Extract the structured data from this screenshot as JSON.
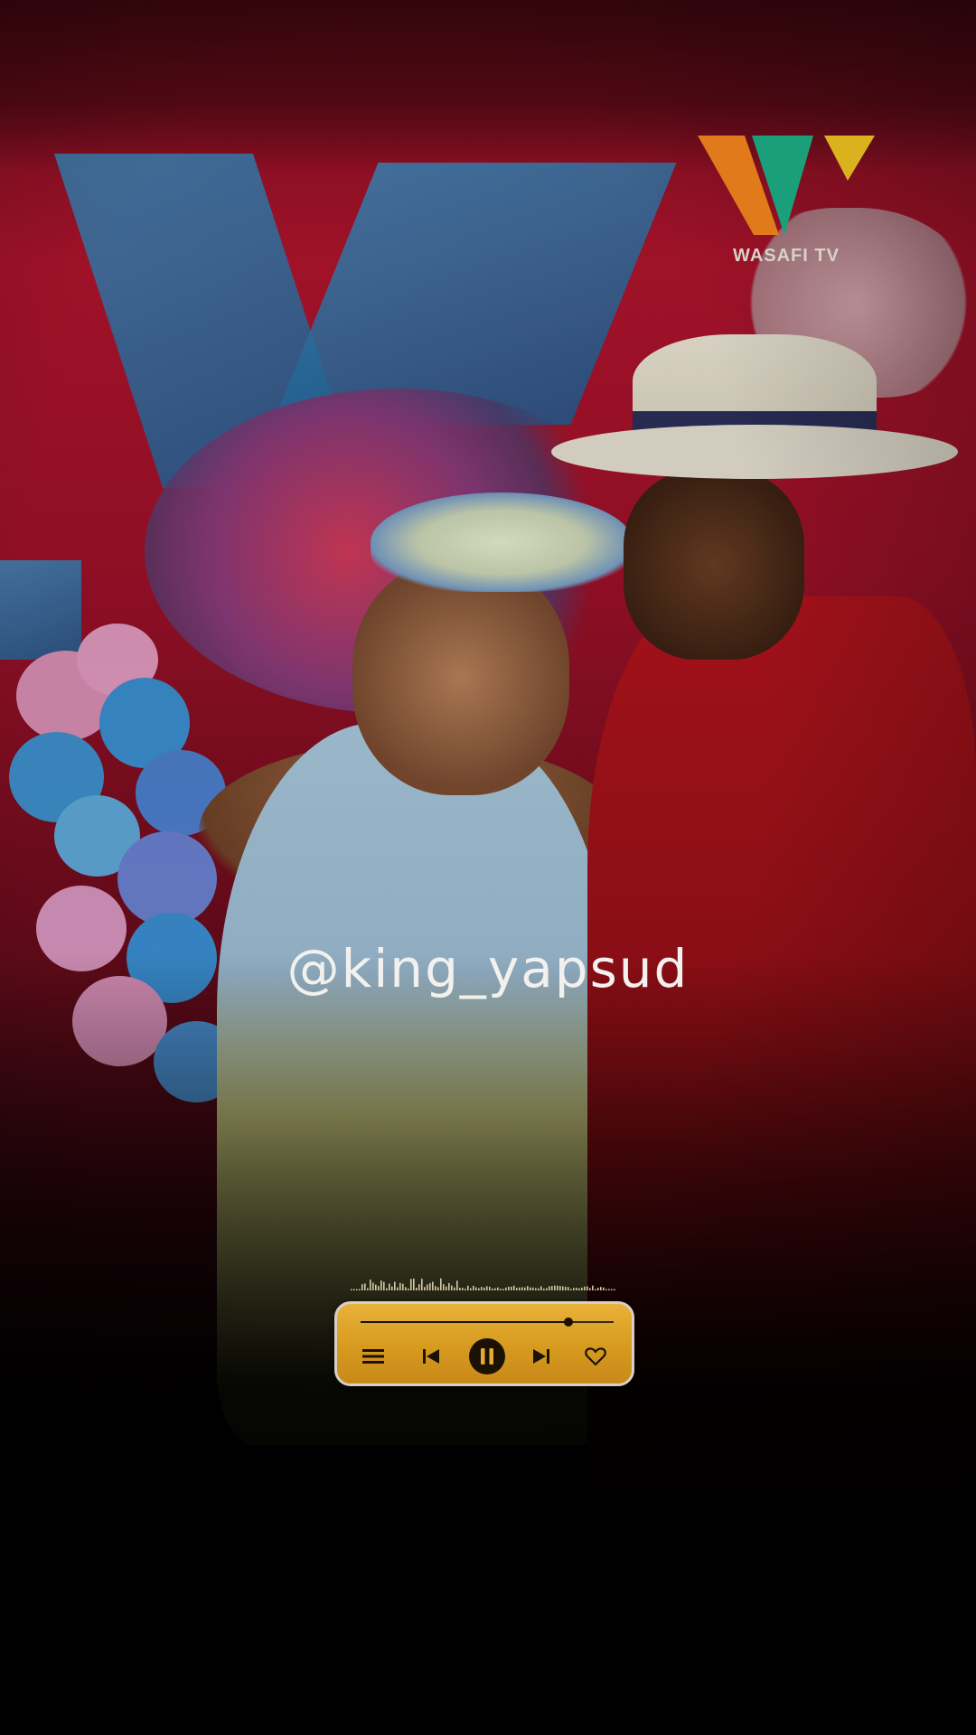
{
  "overlay": {
    "username": "@king_yapsud"
  },
  "logo": {
    "text": "WASAFI TV",
    "colors": [
      "#e07a1a",
      "#1a9f7a",
      "#d9b21e"
    ]
  },
  "player": {
    "progress": 0.82,
    "state": "playing",
    "background_color": "#e1a42e",
    "buttons": {
      "menu": "menu-icon",
      "previous": "skip-previous-icon",
      "play_pause": "pause-icon",
      "next": "skip-next-icon",
      "favorite": "heart-icon"
    }
  }
}
